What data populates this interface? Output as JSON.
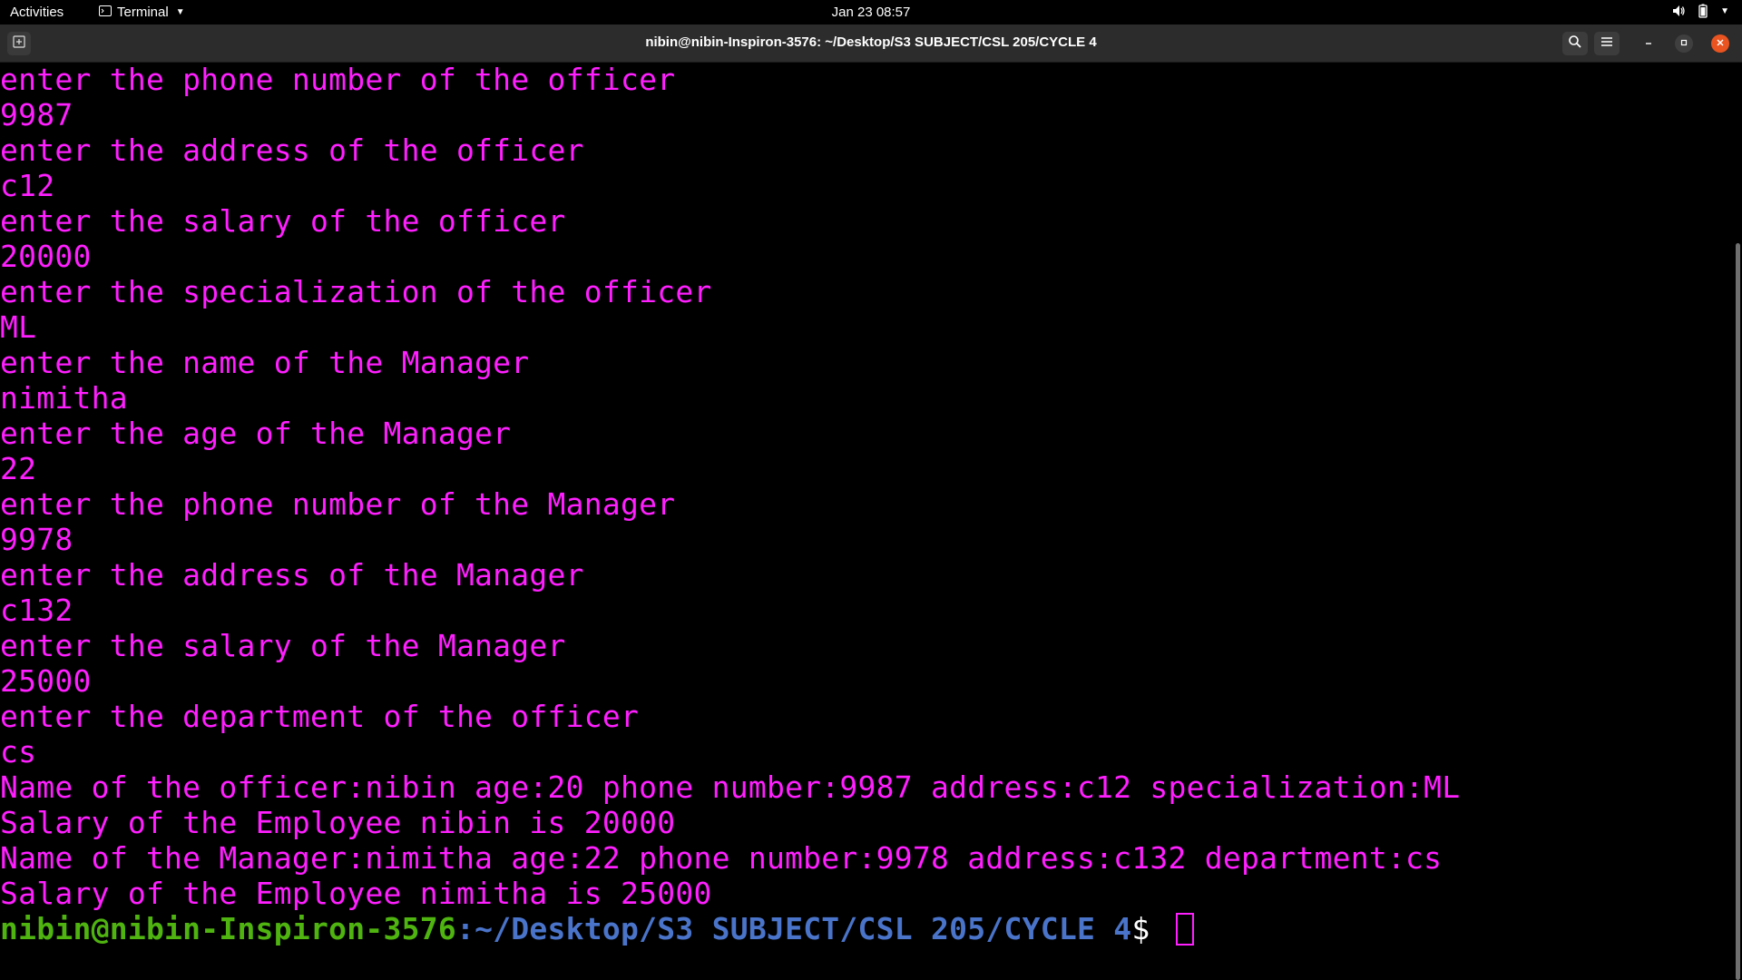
{
  "topbar": {
    "activities": "Activities",
    "app_name": "Terminal",
    "clock": "Jan 23  08:57"
  },
  "window": {
    "title": "nibin@nibin-Inspiron-3576: ~/Desktop/S3 SUBJECT/CSL 205/CYCLE 4"
  },
  "terminal": {
    "lines": [
      "enter the phone number of the officer",
      "9987",
      "enter the address of the officer",
      "c12",
      "enter the salary of the officer",
      "20000",
      "enter the specialization of the officer",
      "ML",
      "enter the name of the Manager",
      "nimitha",
      "enter the age of the Manager",
      "22",
      "enter the phone number of the Manager",
      "9978",
      "enter the address of the Manager",
      "c132",
      "enter the salary of the Manager",
      "25000",
      "enter the department of the officer",
      "cs",
      "Name of the officer:nibin age:20 phone number:9987 address:c12 specialization:ML",
      "Salary of the Employee nibin is 20000",
      "Name of the Manager:nimitha age:22 phone number:9978 address:c132 department:cs",
      "Salary of the Employee nimitha is 25000"
    ],
    "prompt": {
      "user_host": "nibin@nibin-Inspiron-3576",
      "path": ":~/Desktop/S3 SUBJECT/CSL 205/CYCLE 4",
      "symbol": "$ "
    }
  },
  "colors": {
    "output_text": "#ff1fff",
    "prompt_user": "#4fb310",
    "prompt_path": "#4a74c9",
    "close_button": "#e95420"
  },
  "icons": {
    "new_tab": "new-tab-icon",
    "search": "search-icon",
    "menu": "hamburger-menu-icon",
    "minimize": "minimize-icon",
    "maximize": "maximize-icon",
    "close": "close-icon",
    "volume": "volume-icon",
    "battery": "battery-icon",
    "system_menu": "chevron-down-icon"
  }
}
